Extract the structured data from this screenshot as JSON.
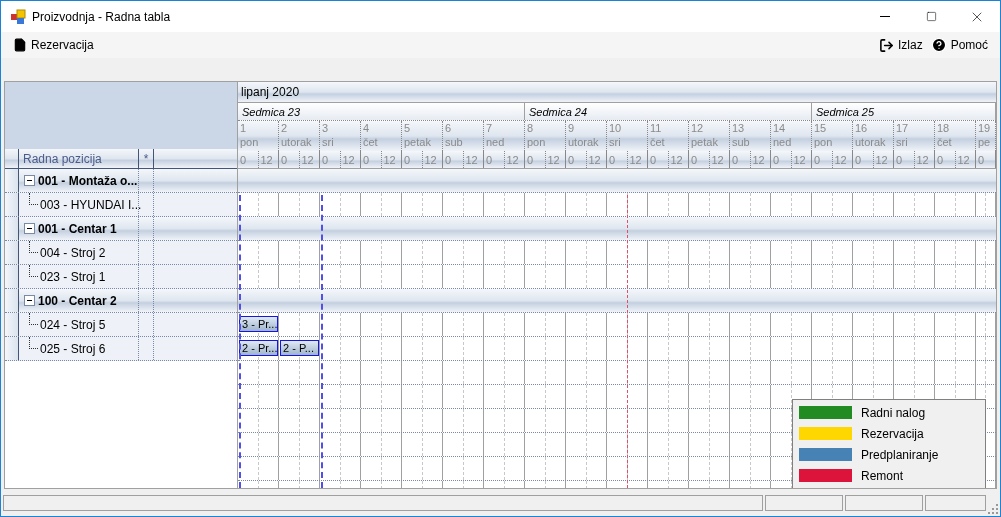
{
  "window": {
    "title": "Proizvodnja - Radna tabla"
  },
  "toolbar": {
    "left": [
      {
        "label": "Rezervacija",
        "kind": "document"
      }
    ],
    "right": [
      {
        "label": "Izlaz",
        "kind": "exit"
      },
      {
        "label": "Pomoć",
        "kind": "help"
      }
    ]
  },
  "grid": {
    "columns": [
      "Radna pozicija",
      "*"
    ],
    "month": "lipanj 2020",
    "weeks": [
      {
        "label": "Sedmica 23",
        "days": [
          {
            "day": "1",
            "weekday": "pon",
            "hours": [
              "0",
              "12"
            ]
          },
          {
            "day": "2",
            "weekday": "utorak",
            "hours": [
              "0",
              "12"
            ]
          },
          {
            "day": "3",
            "weekday": "sri",
            "hours": [
              "0",
              "12"
            ]
          },
          {
            "day": "4",
            "weekday": "čet",
            "hours": [
              "0",
              "12"
            ]
          },
          {
            "day": "5",
            "weekday": "petak",
            "hours": [
              "0",
              "12"
            ]
          },
          {
            "day": "6",
            "weekday": "sub",
            "hours": [
              "0",
              "12"
            ]
          },
          {
            "day": "7",
            "weekday": "ned",
            "hours": [
              "0",
              "12"
            ]
          }
        ]
      },
      {
        "label": "Sedmica 24",
        "days": [
          {
            "day": "8",
            "weekday": "pon",
            "hours": [
              "0",
              "12"
            ]
          },
          {
            "day": "9",
            "weekday": "utorak",
            "hours": [
              "0",
              "12"
            ]
          },
          {
            "day": "10",
            "weekday": "sri",
            "hours": [
              "0",
              "12"
            ]
          },
          {
            "day": "11",
            "weekday": "čet",
            "hours": [
              "0",
              "12"
            ]
          },
          {
            "day": "12",
            "weekday": "petak",
            "hours": [
              "0",
              "12"
            ]
          },
          {
            "day": "13",
            "weekday": "sub",
            "hours": [
              "0",
              "12"
            ]
          },
          {
            "day": "14",
            "weekday": "ned",
            "hours": [
              "0",
              "12"
            ]
          }
        ]
      },
      {
        "label": "Sedmica 25",
        "days": [
          {
            "day": "15",
            "weekday": "pon",
            "hours": [
              "0",
              "12"
            ]
          },
          {
            "day": "16",
            "weekday": "utorak",
            "hours": [
              "0",
              "12"
            ]
          },
          {
            "day": "17",
            "weekday": "sri",
            "hours": [
              "0",
              "12"
            ]
          },
          {
            "day": "18",
            "weekday": "čet",
            "hours": [
              "0",
              "12"
            ]
          },
          {
            "day": "19",
            "weekday": "pe",
            "hours": [
              "0"
            ]
          }
        ]
      }
    ],
    "groups": [
      {
        "label": "001 - Montaža o...",
        "expanded": true,
        "children": [
          {
            "label": "003 - HYUNDAI I..."
          }
        ]
      },
      {
        "label": "001 - Centar 1",
        "expanded": true,
        "children": [
          {
            "label": "004 - Stroj 2"
          },
          {
            "label": "023 - Stroj 1"
          }
        ]
      },
      {
        "label": "100 - Centar 2",
        "expanded": true,
        "children": [
          {
            "label": "024 - Stroj 5",
            "bars": [
              "3 - Pr..."
            ]
          },
          {
            "label": "025 - Stroj 6",
            "bars": [
              "2 - Pr...",
              "2 - P..."
            ]
          }
        ]
      }
    ]
  },
  "legend": [
    {
      "label": "Radni nalog",
      "color": "#228b22"
    },
    {
      "label": "Rezervacija",
      "color": "#ffd700"
    },
    {
      "label": "Predplaniranje",
      "color": "#4682b4"
    },
    {
      "label": "Remont",
      "color": "#dc143c"
    }
  ]
}
